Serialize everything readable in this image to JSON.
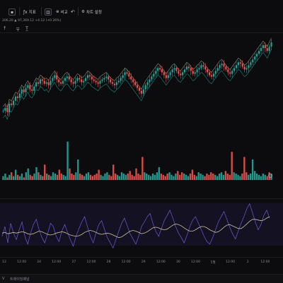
{
  "toolbar": {
    "symbol_label": "",
    "indicators_label": "지표",
    "chart_type_label": "캔들",
    "compare_label": "비교",
    "undo_icon": "undo-icon",
    "settings_label": "차트 설정",
    "menu_icon": "menu-icon"
  },
  "infobar": {
    "text": "206.20  ▲ 97,369.12  +4.12 (+0.26%)"
  },
  "toolbar2": {
    "tools": [
      "↑",
      "〒",
      "T̲"
    ]
  },
  "time_axis": {
    "labels": [
      "12",
      "12:00",
      "24",
      "12:00",
      "27",
      "12:00",
      "28",
      "12:00",
      "29",
      "12:00",
      "30",
      "12:00",
      "5월",
      "12:00",
      "2",
      "12:00"
    ]
  },
  "footer": {
    "left_label": "V",
    "tab_label": "트레이딩패널"
  },
  "colors": {
    "up": "#26a69a",
    "down": "#ef5350",
    "osc_line": "#6b5bd6",
    "osc_signal": "#c9c19a",
    "band": "#c8c8a0"
  },
  "chart_data": [
    {
      "type": "candlestick",
      "title": "",
      "series": [
        {
          "name": "",
          "values": [
            20,
            24,
            18,
            30,
            28,
            34,
            40,
            38,
            44,
            50,
            46,
            52,
            56,
            50,
            48,
            54,
            60,
            58,
            64,
            62,
            58,
            60,
            56,
            62,
            66,
            70,
            64,
            60,
            58,
            62,
            66,
            68,
            64,
            60,
            58,
            62,
            66,
            64,
            60,
            62,
            66,
            70,
            68,
            64,
            62,
            60,
            58,
            62,
            64,
            66,
            68,
            64,
            60,
            58,
            56,
            60,
            62,
            66,
            70,
            74,
            72,
            68,
            64,
            60,
            56,
            52,
            48,
            44,
            50,
            56,
            60,
            64,
            68,
            72,
            76,
            80,
            78,
            74,
            70,
            66,
            70,
            74,
            78,
            80,
            76,
            72,
            70,
            74,
            78,
            82,
            80,
            76,
            72,
            74,
            78,
            80,
            84,
            82,
            78,
            74,
            70,
            68,
            72,
            76,
            80,
            84,
            86,
            82,
            78,
            74,
            72,
            76,
            80,
            84,
            88,
            86,
            82,
            78,
            80,
            84,
            88,
            92,
            96,
            100,
            104,
            108,
            112,
            108,
            104,
            110,
            116
          ]
        }
      ]
    },
    {
      "type": "bar",
      "title": "",
      "series": [
        {
          "name": "",
          "values": [
            3,
            5,
            2,
            4,
            6,
            3,
            8,
            4,
            3,
            5,
            2,
            6,
            9,
            4,
            3,
            5,
            10,
            6,
            4,
            3,
            12,
            5,
            4,
            3,
            6,
            5,
            4,
            8,
            5,
            4,
            3,
            30,
            9,
            5,
            4,
            6,
            16,
            5,
            4,
            3,
            5,
            6,
            4,
            3,
            4,
            5,
            8,
            4,
            3,
            5,
            6,
            4,
            3,
            12,
            5,
            4,
            3,
            6,
            5,
            4,
            5,
            7,
            4,
            3,
            9,
            5,
            4,
            18,
            6,
            5,
            4,
            3,
            5,
            4,
            6,
            10,
            5,
            4,
            3,
            5,
            6,
            4,
            3,
            5,
            7,
            4,
            6,
            5,
            4,
            3,
            5,
            8,
            4,
            3,
            6,
            5,
            4,
            3,
            5,
            4,
            6,
            5,
            4,
            3,
            5,
            6,
            4,
            7,
            5,
            4,
            22,
            6,
            5,
            4,
            3,
            5,
            18,
            6,
            4,
            5,
            16,
            7,
            5,
            4,
            3,
            5,
            4,
            3,
            6,
            5
          ]
        }
      ]
    },
    {
      "type": "line",
      "title": "",
      "series": [
        {
          "name": "",
          "values": [
            40,
            55,
            30,
            60,
            45,
            35,
            50,
            62,
            40,
            28,
            45,
            58,
            66,
            50,
            38,
            30,
            44,
            60,
            55,
            40,
            32,
            48,
            58,
            46,
            35,
            25,
            40,
            52,
            62,
            70,
            55,
            40,
            30,
            45,
            58,
            64,
            50,
            38,
            30,
            22,
            35,
            48,
            60,
            68,
            56,
            44,
            36,
            28,
            40,
            55,
            62,
            70,
            75,
            60,
            48,
            40,
            52,
            64,
            72,
            80,
            68,
            55,
            45,
            38,
            30,
            42,
            55,
            65,
            70,
            60,
            50,
            40,
            32,
            28,
            38,
            50,
            62,
            70,
            78,
            66,
            54,
            44,
            36,
            48,
            60,
            70,
            82,
            90,
            76,
            62,
            50,
            58,
            72,
            80,
            68
          ]
        },
        {
          "name": "",
          "values": [
            45,
            46,
            44,
            45,
            46,
            45,
            46,
            47,
            46,
            44,
            43,
            44,
            46,
            48,
            47,
            45,
            43,
            42,
            43,
            45,
            46,
            47,
            46,
            44,
            42,
            41,
            40,
            41,
            43,
            46,
            48,
            49,
            48,
            46,
            44,
            43,
            44,
            45,
            44,
            42,
            40,
            38,
            39,
            42,
            45,
            48,
            49,
            48,
            46,
            44,
            45,
            47,
            50,
            53,
            54,
            53,
            51,
            50,
            51,
            54,
            57,
            59,
            58,
            56,
            53,
            50,
            48,
            48,
            50,
            53,
            55,
            55,
            53,
            50,
            48,
            46,
            47,
            50,
            54,
            57,
            58,
            56,
            54,
            52,
            52,
            55,
            59,
            63,
            66,
            66,
            65,
            64,
            65,
            68,
            70
          ]
        }
      ]
    }
  ]
}
